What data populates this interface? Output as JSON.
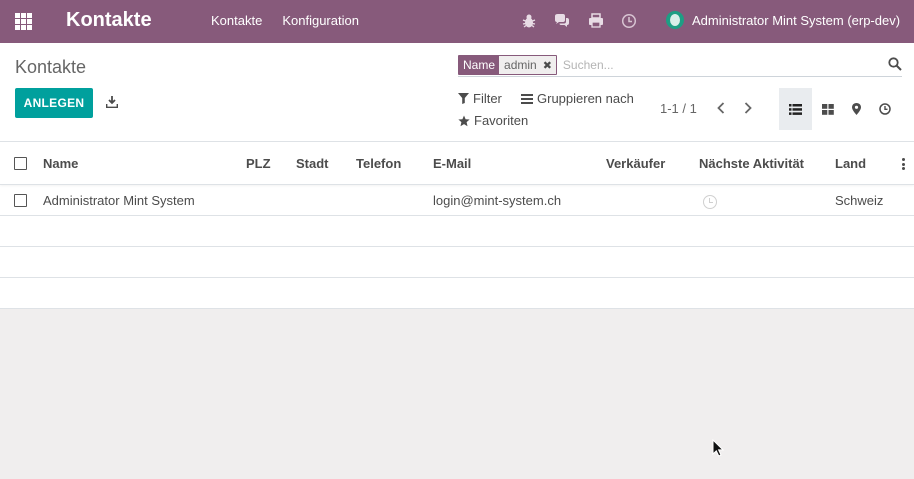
{
  "navbar": {
    "app_title": "Kontakte",
    "menu": [
      "Kontakte",
      "Konfiguration"
    ],
    "user": "Administrator Mint System (erp-dev)",
    "brand_color": "#875a7b"
  },
  "control_panel": {
    "breadcrumb": "Kontakte",
    "create_label": "ANLEGEN",
    "search": {
      "facet_label": "Name",
      "facet_value": "admin",
      "placeholder": "Suchen..."
    },
    "filter_label": "Filter",
    "group_by_label": "Gruppieren nach",
    "favorites_label": "Favoriten",
    "pager": "1-1 / 1",
    "views": [
      "list-icon",
      "kanban-icon",
      "map-marker-icon",
      "activity-clock-icon"
    ],
    "active_view": "list-icon",
    "accent_color": "#00a09d"
  },
  "list": {
    "columns": [
      "Name",
      "PLZ",
      "Stadt",
      "Telefon",
      "E-Mail",
      "Verkäufer",
      "Nächste Aktivität",
      "Land"
    ],
    "rows": [
      {
        "name": "Administrator Mint System",
        "zip": "",
        "city": "",
        "phone": "",
        "email": "login@mint-system.ch",
        "salesperson": "",
        "activity_icon": "clock-icon",
        "country": "Schweiz"
      }
    ]
  }
}
